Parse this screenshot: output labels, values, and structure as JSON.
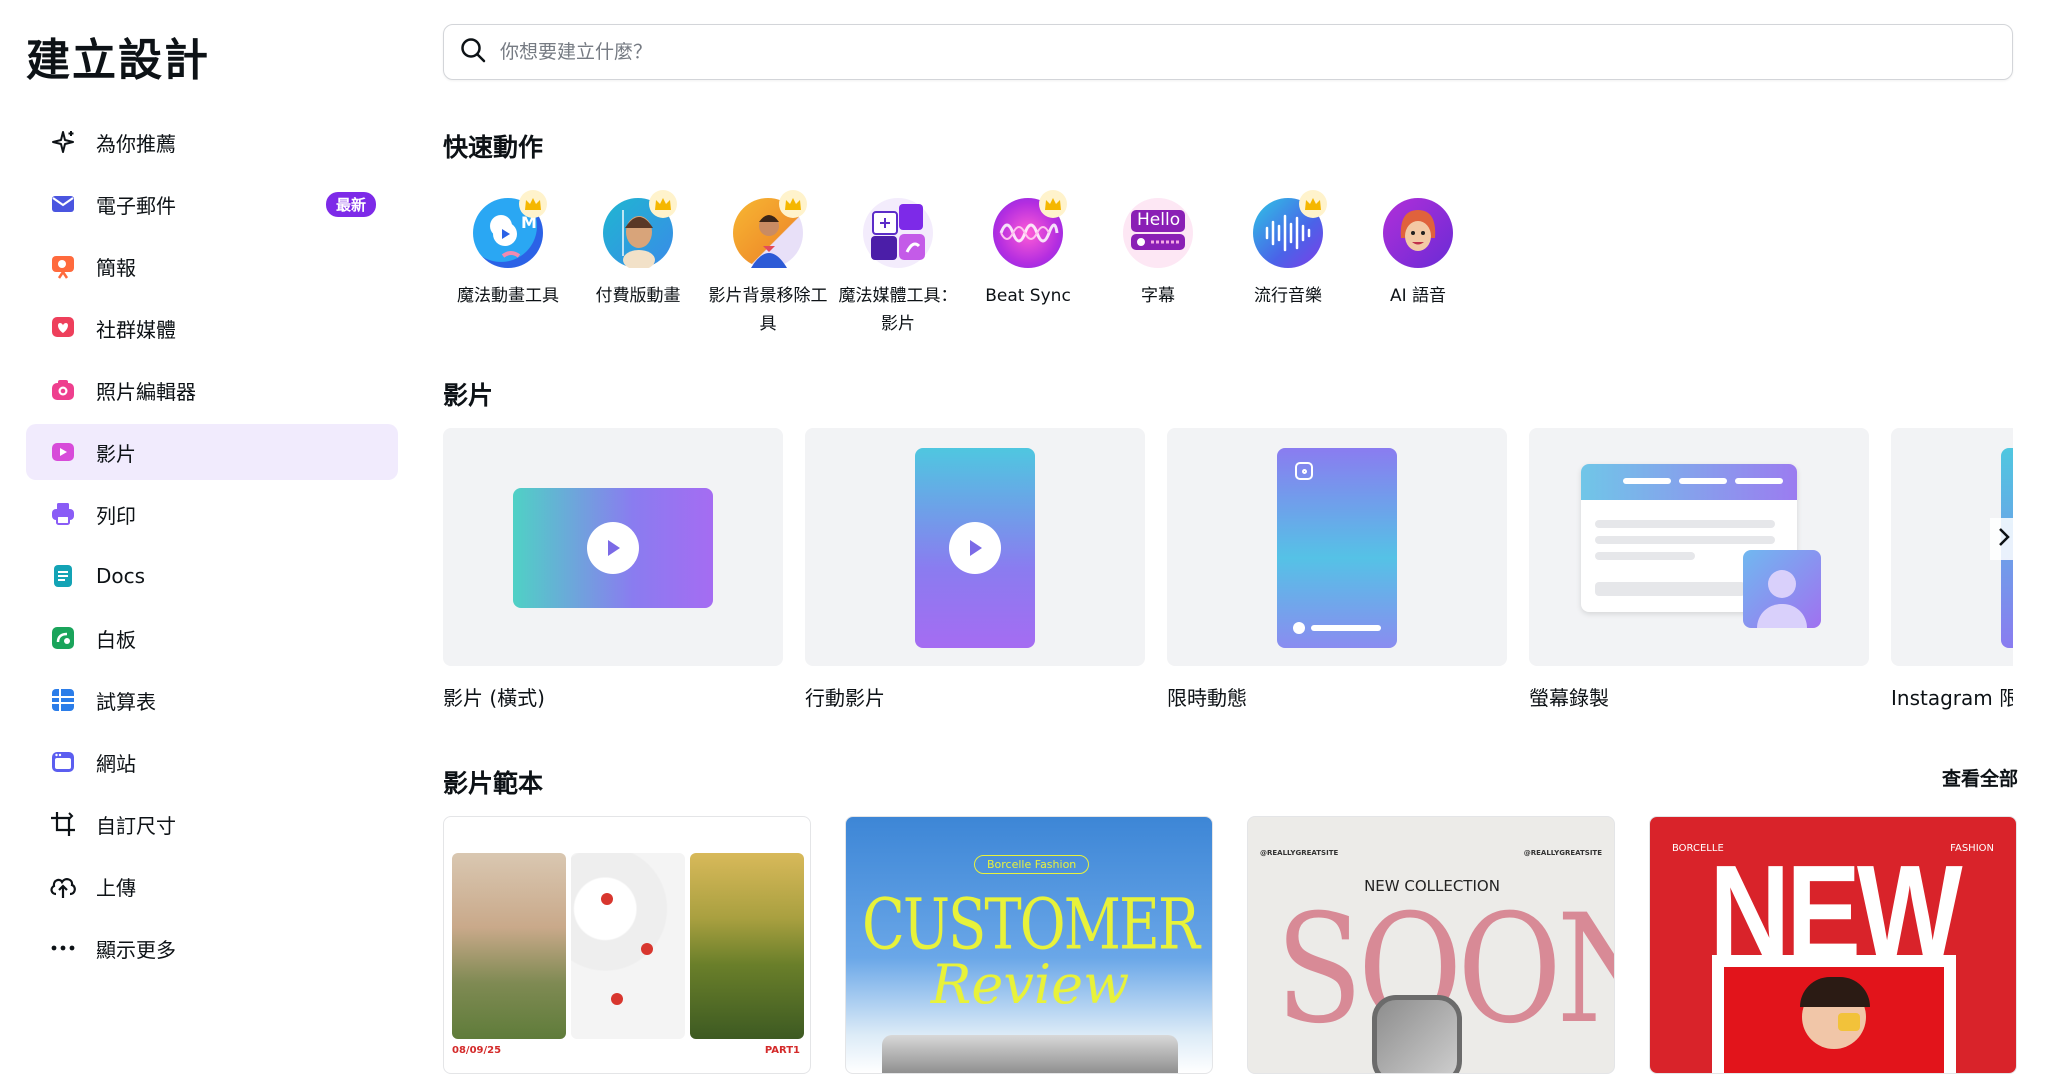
{
  "sidebar": {
    "title": "建立設計",
    "items": [
      {
        "label": "為你推薦",
        "icon": "sparkle-icon"
      },
      {
        "label": "電子郵件",
        "icon": "envelope-icon",
        "badge": "最新"
      },
      {
        "label": "簡報",
        "icon": "presentation-icon"
      },
      {
        "label": "社群媒體",
        "icon": "heart-icon"
      },
      {
        "label": "照片編輯器",
        "icon": "camera-icon"
      },
      {
        "label": "影片",
        "icon": "video-icon",
        "active": true
      },
      {
        "label": "列印",
        "icon": "printer-icon"
      },
      {
        "label": "Docs",
        "icon": "doc-icon"
      },
      {
        "label": "白板",
        "icon": "whiteboard-icon"
      },
      {
        "label": "試算表",
        "icon": "spreadsheet-icon"
      },
      {
        "label": "網站",
        "icon": "website-icon"
      },
      {
        "label": "自訂尺寸",
        "icon": "crop-icon"
      },
      {
        "label": "上傳",
        "icon": "cloud-upload-icon"
      },
      {
        "label": "顯示更多",
        "icon": "more-icon"
      }
    ]
  },
  "search": {
    "placeholder": "你想要建立什麼？"
  },
  "quick_actions": {
    "title": "快速動作",
    "items": [
      {
        "label": "魔法動畫工具",
        "icon": "magic-animate-icon",
        "premium": true
      },
      {
        "label": "付費版動畫",
        "icon": "premium-animation-icon",
        "premium": true
      },
      {
        "label": "影片背景移除工具",
        "icon": "background-remover-icon",
        "premium": true
      },
      {
        "label": "魔法媒體工具：影片",
        "icon": "magic-media-icon",
        "premium": false
      },
      {
        "label": "Beat Sync",
        "icon": "beat-sync-icon",
        "premium": true
      },
      {
        "label": "字幕",
        "icon": "captions-icon",
        "premium": false,
        "icon_text": "Hello"
      },
      {
        "label": "流行音樂",
        "icon": "music-icon",
        "premium": true
      },
      {
        "label": "AI 語音",
        "icon": "ai-voice-icon",
        "premium": false
      }
    ]
  },
  "videos": {
    "title": "影片",
    "items": [
      {
        "label": "影片 (橫式)",
        "icon": "landscape-video-icon"
      },
      {
        "label": "行動影片",
        "icon": "mobile-video-icon"
      },
      {
        "label": "限時動態",
        "icon": "story-icon"
      },
      {
        "label": "螢幕錄製",
        "icon": "screen-record-icon"
      },
      {
        "label": "Instagram 限時動態影片",
        "icon": "instagram-story-icon"
      }
    ]
  },
  "templates": {
    "title": "影片範本",
    "see_all": "查看全部",
    "items": [
      {
        "name": "photo-collage-template",
        "date": "08/09/25",
        "part": "PART1"
      },
      {
        "name": "customer-review-template",
        "brand": "Borcelle Fashion",
        "headline": "CUSTOMER",
        "script": "Review"
      },
      {
        "name": "new-collection-template",
        "handle_left": "@REALLYGREATSITE",
        "handle_right": "@REALLYGREATSITE",
        "sub": "NEW COLLECTION",
        "headline": "SOON"
      },
      {
        "name": "new-fashion-template",
        "brand_left": "BORCELLE",
        "brand_right": "FASHION",
        "headline": "NEW"
      }
    ]
  },
  "colors": {
    "accent": "#7d2ae8",
    "active_bg": "#f1ebfd"
  }
}
